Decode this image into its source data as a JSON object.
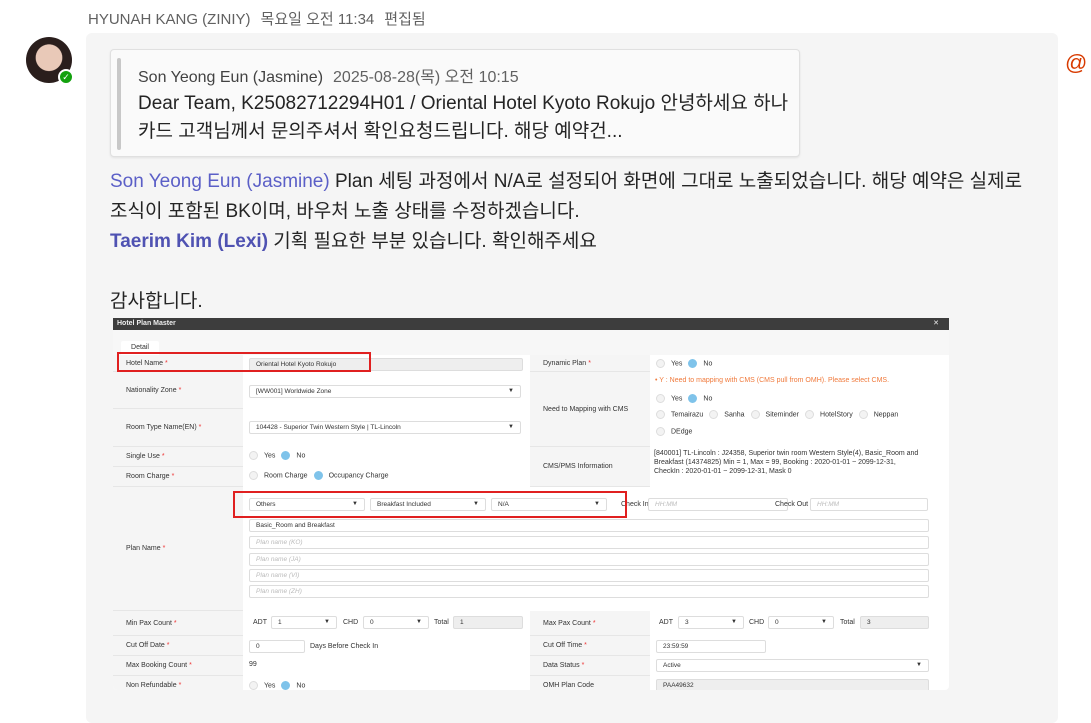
{
  "header": {
    "author": "HYUNAH KANG (ZINIY)",
    "time": "목요일 오전 11:34",
    "edited": "편집됨"
  },
  "quote": {
    "author": "Son Yeong Eun (Jasmine)",
    "time": "2025-08-28(목) 오전 10:15",
    "text": "Dear Team, K25082712294H01 / Oriental Hotel Kyoto Rokujo 안녕하세요 하나카드 고객님께서 문의주셔서 확인요청드립니다. 해당 예약건..."
  },
  "message": {
    "mention1": "Son Yeong Eun (Jasmine)",
    "line1": " Plan 세팅 과정에서 N/A로 설정되어 화면에 그대로 노출되었습니다. 해당 예약은 실제로 조식이 포함된 BK이며, 바우처 노출 상태를 수정하겠습니다.",
    "mention2": "Taerim Kim (Lexi)",
    "line2": " 기획 필요한 부분 있습니다. 확인해주세요",
    "thanks": "감사합니다."
  },
  "icons": {
    "at": "@",
    "check": "✓"
  },
  "shot": {
    "title": "Hotel Plan Master",
    "close": "✕",
    "tab": "Detail",
    "req": "*",
    "hotel_name_label": "Hotel Name",
    "hotel_name": "Oriental Hotel Kyoto Rokujo",
    "nationality_label": "Nationality Zone",
    "nationality": "[WW001] Worldwide Zone",
    "room_type_label": "Room Type Name(EN)",
    "room_type": "104428 - Superior Twin Western Style | TL-Lincoln",
    "single_use_label": "Single Use",
    "yes": "Yes",
    "no": "No",
    "room_charge_label": "Room Charge",
    "room_charge": "Room Charge",
    "occupancy_charge": "Occupancy Charge",
    "dynamic_plan_label": "Dynamic Plan",
    "mapping_label": "Need to Mapping with CMS",
    "mapping_note": "• Y : Need to mapping with CMS (CMS pull from OMH). Please select CMS.",
    "cms": [
      "Temairazu",
      "Sanha",
      "Siteminder",
      "HotelStory",
      "Neppan",
      "DEdge"
    ],
    "cms_info_label": "CMS/PMS Information",
    "cms_info": "[840001] TL-Lincoln : J24358, Superior twin room   Western Style(4), Basic_Room and Breakfast (14374825) Min = 1, Max = 99, Booking : 2020-01-01 ~ 2099-12-31, CheckIn : 2020-01-01 ~ 2099-12-31, Mask 0",
    "plan_name_label": "Plan Name",
    "plan_type": "Others",
    "meal": "Breakfast Included",
    "meal_sub": "N/A",
    "check_in_label": "Check In",
    "check_out_label": "Check Out",
    "hhmm": "HH:MM",
    "plan_name_en": "Basic_Room and Breakfast",
    "ph_ko": "Plan name (KO)",
    "ph_ja": "Plan name (JA)",
    "ph_vi": "Plan name (VI)",
    "ph_zh": "Plan name (ZH)",
    "min_pax_label": "Min Pax Count",
    "max_pax_label": "Max Pax Count",
    "adt": "ADT",
    "chd": "CHD",
    "total": "Total",
    "min_adt": "1",
    "min_chd": "0",
    "min_total": "1",
    "max_adt": "3",
    "max_chd": "0",
    "max_total": "3",
    "cutoff_date_label": "Cut Off Date",
    "cutoff_date": "0",
    "days_before": "Days Before Check In",
    "cutoff_time_label": "Cut Off Time",
    "cutoff_time": "23:59:59",
    "max_booking_label": "Max Booking Count",
    "max_booking": "99",
    "data_status_label": "Data Status",
    "data_status": "Active",
    "non_refundable_label": "Non Refundable",
    "omh_code_label": "OMH Plan Code",
    "omh_code": "PAA49632"
  }
}
